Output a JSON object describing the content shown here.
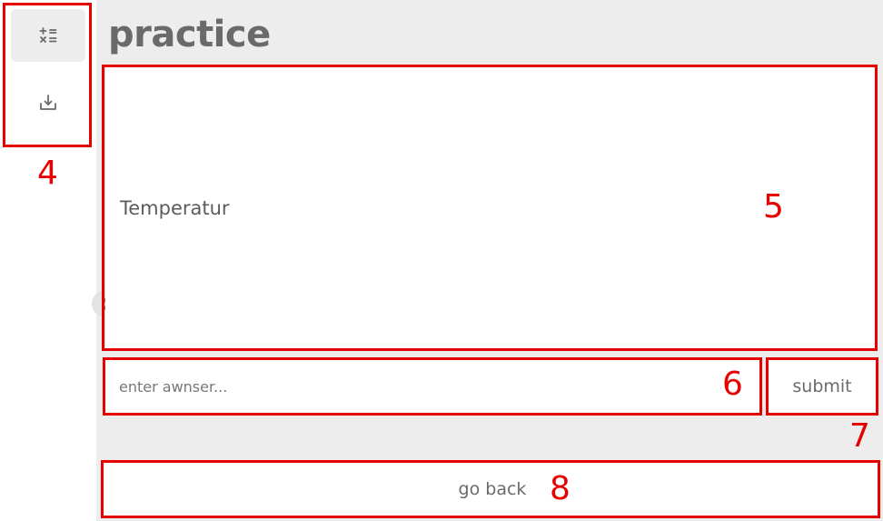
{
  "sidebar": {
    "items": [
      {
        "icon": "calculator-icon",
        "active": true
      },
      {
        "icon": "download-icon",
        "active": false
      }
    ]
  },
  "header": {
    "title": "practice"
  },
  "question": {
    "text": "Temperatur"
  },
  "answer": {
    "placeholder": "enter awnser..."
  },
  "actions": {
    "submit_label": "submit",
    "back_label": "go back"
  },
  "annotations": {
    "n4": "4",
    "n5": "5",
    "n6": "6",
    "n7": "7",
    "n8": "8"
  },
  "colors": {
    "annotation": "#e60000",
    "background": "#ededed",
    "text": "#6a6a6a"
  }
}
